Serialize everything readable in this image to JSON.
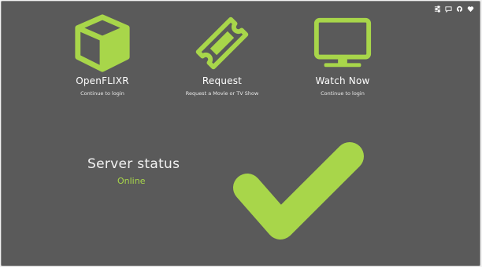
{
  "colors": {
    "background": "#5a5a5a",
    "accent": "#a8d64a",
    "text": "#ffffff"
  },
  "top_icons": [
    "sliders-icon",
    "chat-icon",
    "github-icon",
    "heart-icon"
  ],
  "tiles": [
    {
      "icon": "cube-icon",
      "title": "OpenFLIXR",
      "subtitle": "Continue to login"
    },
    {
      "icon": "ticket-icon",
      "title": "Request",
      "subtitle": "Request a Movie or TV Show"
    },
    {
      "icon": "tv-icon",
      "title": "Watch Now",
      "subtitle": "Continue to login"
    }
  ],
  "server_status": {
    "label": "Server status",
    "value": "Online",
    "indicator_icon": "checkmark-icon"
  }
}
